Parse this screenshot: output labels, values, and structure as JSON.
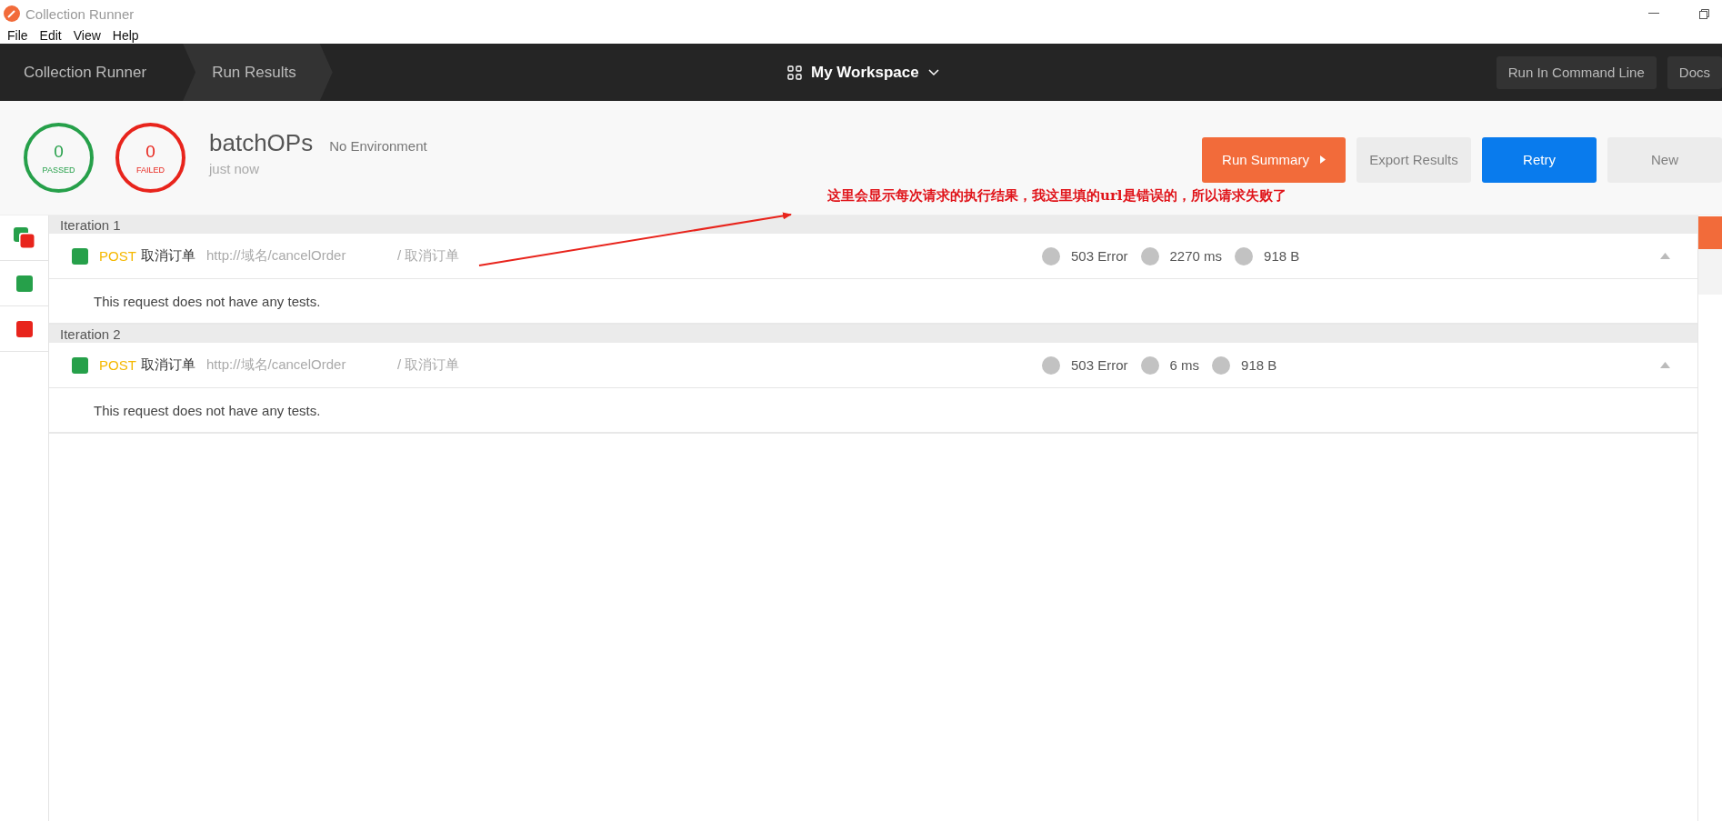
{
  "window": {
    "title": "Collection Runner"
  },
  "menu": [
    "File",
    "Edit",
    "View",
    "Help"
  ],
  "breadcrumbs": [
    {
      "label": "Collection Runner",
      "selected": false
    },
    {
      "label": "Run Results",
      "selected": true
    }
  ],
  "workspace": {
    "label": "My Workspace"
  },
  "toolbar_buttons": [
    "Run In Command Line",
    "Docs"
  ],
  "summary": {
    "passed": {
      "count": "0",
      "label": "PASSED"
    },
    "failed": {
      "count": "0",
      "label": "FAILED"
    },
    "collection": "batchOPs",
    "environment": "No Environment",
    "time": "just now"
  },
  "actions": [
    {
      "label": "Run Summary",
      "kind": "summary"
    },
    {
      "label": "Export Results",
      "kind": "plain"
    },
    {
      "label": "Retry",
      "kind": "primary"
    },
    {
      "label": "New",
      "kind": "plain"
    }
  ],
  "annotation": "这里会显示每次请求的执行结果，我这里填的url是错误的，所以请求失败了",
  "sidebar": [
    {
      "kind": "mixed"
    },
    {
      "kind": "passed"
    },
    {
      "kind": "failed"
    }
  ],
  "iterations": [
    {
      "title": "Iteration 1",
      "request": {
        "kind": "passed",
        "method": "POST",
        "name": "取消订单",
        "url": "http://域名/cancelOrder",
        "path": "/ 取消订单",
        "code": "503 Error",
        "time": "2270 ms",
        "size": "918 B"
      },
      "tests": "This request does not have any tests."
    },
    {
      "title": "Iteration 2",
      "request": {
        "kind": "passed",
        "method": "POST",
        "name": "取消订单",
        "url": "http://域名/cancelOrder",
        "path": "/ 取消订单",
        "code": "503 Error",
        "time": "6 ms",
        "size": "918 B"
      },
      "tests": "This request does not have any tests."
    }
  ]
}
